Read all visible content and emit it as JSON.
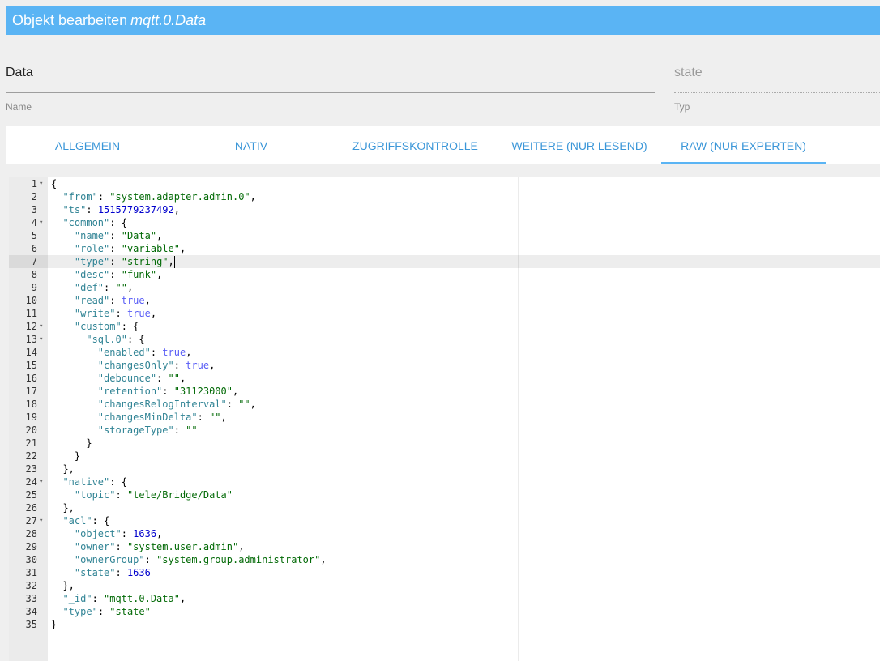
{
  "title": {
    "prefix": "Objekt bearbeiten",
    "object_id": "mqtt.0.Data"
  },
  "fields": {
    "name": {
      "value": "Data",
      "label": "Name"
    },
    "type": {
      "value": "state",
      "label": "Typ"
    }
  },
  "tabs": [
    {
      "label": "ALLGEMEIN",
      "active": false
    },
    {
      "label": "NATIV",
      "active": false
    },
    {
      "label": "ZUGRIFFSKONTROLLE",
      "active": false
    },
    {
      "label": "WEITERE (NUR LESEND)",
      "active": false
    },
    {
      "label": "RAW (NUR EXPERTEN)",
      "active": true
    }
  ],
  "editor": {
    "active_line": 7,
    "lines": [
      {
        "no": "1",
        "fold": true,
        "indent": "",
        "tokens": [
          [
            "p",
            "{"
          ]
        ]
      },
      {
        "no": "2",
        "fold": false,
        "indent": "  ",
        "tokens": [
          [
            "k",
            "\"from\""
          ],
          [
            "p",
            ": "
          ],
          [
            "sv",
            "\"system.adapter.admin.0\""
          ],
          [
            "p",
            ","
          ]
        ]
      },
      {
        "no": "3",
        "fold": false,
        "indent": "  ",
        "tokens": [
          [
            "k",
            "\"ts\""
          ],
          [
            "p",
            ": "
          ],
          [
            "n",
            "1515779237492"
          ],
          [
            "p",
            ","
          ]
        ]
      },
      {
        "no": "4",
        "fold": true,
        "indent": "  ",
        "tokens": [
          [
            "k",
            "\"common\""
          ],
          [
            "p",
            ": {"
          ]
        ]
      },
      {
        "no": "5",
        "fold": false,
        "indent": "    ",
        "tokens": [
          [
            "k",
            "\"name\""
          ],
          [
            "p",
            ": "
          ],
          [
            "sv",
            "\"Data\""
          ],
          [
            "p",
            ","
          ]
        ]
      },
      {
        "no": "6",
        "fold": false,
        "indent": "    ",
        "tokens": [
          [
            "k",
            "\"role\""
          ],
          [
            "p",
            ": "
          ],
          [
            "sv",
            "\"variable\""
          ],
          [
            "p",
            ","
          ]
        ]
      },
      {
        "no": "7",
        "fold": false,
        "indent": "    ",
        "tokens": [
          [
            "k",
            "\"type\""
          ],
          [
            "p",
            ": "
          ],
          [
            "sv",
            "\"string\""
          ],
          [
            "p",
            ","
          ]
        ]
      },
      {
        "no": "8",
        "fold": false,
        "indent": "    ",
        "tokens": [
          [
            "k",
            "\"desc\""
          ],
          [
            "p",
            ": "
          ],
          [
            "sv",
            "\"funk\""
          ],
          [
            "p",
            ","
          ]
        ]
      },
      {
        "no": "9",
        "fold": false,
        "indent": "    ",
        "tokens": [
          [
            "k",
            "\"def\""
          ],
          [
            "p",
            ": "
          ],
          [
            "sv",
            "\"\""
          ],
          [
            "p",
            ","
          ]
        ]
      },
      {
        "no": "10",
        "fold": false,
        "indent": "    ",
        "tokens": [
          [
            "k",
            "\"read\""
          ],
          [
            "p",
            ": "
          ],
          [
            "b",
            "true"
          ],
          [
            "p",
            ","
          ]
        ]
      },
      {
        "no": "11",
        "fold": false,
        "indent": "    ",
        "tokens": [
          [
            "k",
            "\"write\""
          ],
          [
            "p",
            ": "
          ],
          [
            "b",
            "true"
          ],
          [
            "p",
            ","
          ]
        ]
      },
      {
        "no": "12",
        "fold": true,
        "indent": "    ",
        "tokens": [
          [
            "k",
            "\"custom\""
          ],
          [
            "p",
            ": {"
          ]
        ]
      },
      {
        "no": "13",
        "fold": true,
        "indent": "      ",
        "tokens": [
          [
            "k",
            "\"sql.0\""
          ],
          [
            "p",
            ": {"
          ]
        ]
      },
      {
        "no": "14",
        "fold": false,
        "indent": "        ",
        "tokens": [
          [
            "k",
            "\"enabled\""
          ],
          [
            "p",
            ": "
          ],
          [
            "b",
            "true"
          ],
          [
            "p",
            ","
          ]
        ]
      },
      {
        "no": "15",
        "fold": false,
        "indent": "        ",
        "tokens": [
          [
            "k",
            "\"changesOnly\""
          ],
          [
            "p",
            ": "
          ],
          [
            "b",
            "true"
          ],
          [
            "p",
            ","
          ]
        ]
      },
      {
        "no": "16",
        "fold": false,
        "indent": "        ",
        "tokens": [
          [
            "k",
            "\"debounce\""
          ],
          [
            "p",
            ": "
          ],
          [
            "sv",
            "\"\""
          ],
          [
            "p",
            ","
          ]
        ]
      },
      {
        "no": "17",
        "fold": false,
        "indent": "        ",
        "tokens": [
          [
            "k",
            "\"retention\""
          ],
          [
            "p",
            ": "
          ],
          [
            "sv",
            "\"31123000\""
          ],
          [
            "p",
            ","
          ]
        ]
      },
      {
        "no": "18",
        "fold": false,
        "indent": "        ",
        "tokens": [
          [
            "k",
            "\"changesRelogInterval\""
          ],
          [
            "p",
            ": "
          ],
          [
            "sv",
            "\"\""
          ],
          [
            "p",
            ","
          ]
        ]
      },
      {
        "no": "19",
        "fold": false,
        "indent": "        ",
        "tokens": [
          [
            "k",
            "\"changesMinDelta\""
          ],
          [
            "p",
            ": "
          ],
          [
            "sv",
            "\"\""
          ],
          [
            "p",
            ","
          ]
        ]
      },
      {
        "no": "20",
        "fold": false,
        "indent": "        ",
        "tokens": [
          [
            "k",
            "\"storageType\""
          ],
          [
            "p",
            ": "
          ],
          [
            "sv",
            "\"\""
          ]
        ]
      },
      {
        "no": "21",
        "fold": false,
        "indent": "      ",
        "tokens": [
          [
            "p",
            "}"
          ]
        ]
      },
      {
        "no": "22",
        "fold": false,
        "indent": "    ",
        "tokens": [
          [
            "p",
            "}"
          ]
        ]
      },
      {
        "no": "23",
        "fold": false,
        "indent": "  ",
        "tokens": [
          [
            "p",
            "},"
          ]
        ]
      },
      {
        "no": "24",
        "fold": true,
        "indent": "  ",
        "tokens": [
          [
            "k",
            "\"native\""
          ],
          [
            "p",
            ": {"
          ]
        ]
      },
      {
        "no": "25",
        "fold": false,
        "indent": "    ",
        "tokens": [
          [
            "k",
            "\"topic\""
          ],
          [
            "p",
            ": "
          ],
          [
            "sv",
            "\"tele/Bridge/Data\""
          ]
        ]
      },
      {
        "no": "26",
        "fold": false,
        "indent": "  ",
        "tokens": [
          [
            "p",
            "},"
          ]
        ]
      },
      {
        "no": "27",
        "fold": true,
        "indent": "  ",
        "tokens": [
          [
            "k",
            "\"acl\""
          ],
          [
            "p",
            ": {"
          ]
        ]
      },
      {
        "no": "28",
        "fold": false,
        "indent": "    ",
        "tokens": [
          [
            "k",
            "\"object\""
          ],
          [
            "p",
            ": "
          ],
          [
            "n",
            "1636"
          ],
          [
            "p",
            ","
          ]
        ]
      },
      {
        "no": "29",
        "fold": false,
        "indent": "    ",
        "tokens": [
          [
            "k",
            "\"owner\""
          ],
          [
            "p",
            ": "
          ],
          [
            "sv",
            "\"system.user.admin\""
          ],
          [
            "p",
            ","
          ]
        ]
      },
      {
        "no": "30",
        "fold": false,
        "indent": "    ",
        "tokens": [
          [
            "k",
            "\"ownerGroup\""
          ],
          [
            "p",
            ": "
          ],
          [
            "sv",
            "\"system.group.administrator\""
          ],
          [
            "p",
            ","
          ]
        ]
      },
      {
        "no": "31",
        "fold": false,
        "indent": "    ",
        "tokens": [
          [
            "k",
            "\"state\""
          ],
          [
            "p",
            ": "
          ],
          [
            "n",
            "1636"
          ]
        ]
      },
      {
        "no": "32",
        "fold": false,
        "indent": "  ",
        "tokens": [
          [
            "p",
            "},"
          ]
        ]
      },
      {
        "no": "33",
        "fold": false,
        "indent": "  ",
        "tokens": [
          [
            "k",
            "\"_id\""
          ],
          [
            "p",
            ": "
          ],
          [
            "sv",
            "\"mqtt.0.Data\""
          ],
          [
            "p",
            ","
          ]
        ]
      },
      {
        "no": "34",
        "fold": false,
        "indent": "  ",
        "tokens": [
          [
            "k",
            "\"type\""
          ],
          [
            "p",
            ": "
          ],
          [
            "sv",
            "\"state\""
          ]
        ]
      },
      {
        "no": "35",
        "fold": false,
        "indent": "",
        "tokens": [
          [
            "p",
            "}"
          ]
        ]
      }
    ]
  },
  "colors": {
    "title_bar": "#5ab4f4",
    "tab_text": "#3a96d8",
    "key": "#318495",
    "string": "#036a07",
    "number": "#0000cd",
    "boolean": "#585cf6"
  }
}
